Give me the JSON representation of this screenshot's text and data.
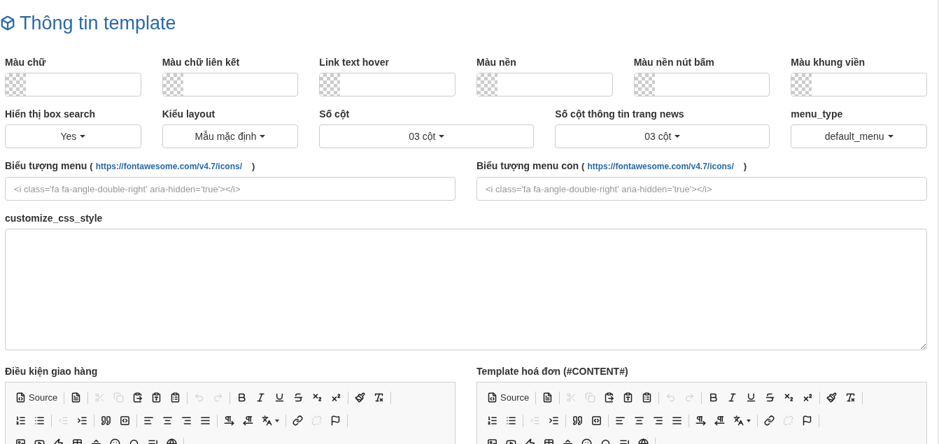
{
  "title": "Thông tin template",
  "color_fields": [
    {
      "label": "Màu chữ"
    },
    {
      "label": "Màu chữ liên kết"
    },
    {
      "label": "Link text hover"
    },
    {
      "label": "Màu nền"
    },
    {
      "label": "Màu nền nút bấm"
    },
    {
      "label": "Màu khung viền"
    }
  ],
  "selects": [
    {
      "label": "Hiển thị box search",
      "value": "Yes",
      "kind": "narrow"
    },
    {
      "label": "Kiểu layout",
      "value": "Mẫu mặc định",
      "kind": "narrow"
    },
    {
      "label": "Số cột",
      "value": "03 cột",
      "kind": "wide"
    },
    {
      "label": "Số cột thông tin trang news",
      "value": "03 cột",
      "kind": "wide"
    },
    {
      "label": "menu_type",
      "value": "default_menu",
      "kind": "narrow"
    }
  ],
  "icon_fields": [
    {
      "label": "Biểu tượng menu",
      "paren_open": "(",
      "link": "https://fontawesome.com/v4.7/icons/",
      "paren_close": ")",
      "placeholder": "<i class='fa fa-angle-double-right' aria-hidden='true'></i>"
    },
    {
      "label": "Biểu tượng menu con",
      "paren_open": "(",
      "link": "https://fontawesome.com/v4.7/icons/",
      "paren_close": ")",
      "placeholder": "<i class='fa fa-angle-double-right' aria-hidden='true'></i>"
    }
  ],
  "css_field": {
    "label": "customize_css_style"
  },
  "editors": [
    {
      "label": "Điều kiện giao hàng",
      "toolbar": [
        [
          [
            {
              "kind": "source",
              "label": "Source",
              "disabled": false
            }
          ],
          [
            {
              "kind": "newpage",
              "disabled": false
            }
          ],
          [
            {
              "kind": "cut",
              "disabled": true
            },
            {
              "kind": "copy",
              "disabled": true
            },
            {
              "kind": "paste",
              "disabled": false
            },
            {
              "kind": "pastetext",
              "disabled": false
            },
            {
              "kind": "pasteword",
              "disabled": false
            }
          ],
          [
            {
              "kind": "undo",
              "disabled": true
            },
            {
              "kind": "redo",
              "disabled": true
            }
          ],
          [
            {
              "kind": "bold",
              "disabled": false
            },
            {
              "kind": "italic",
              "disabled": false
            },
            {
              "kind": "underline",
              "disabled": false
            },
            {
              "kind": "strike",
              "disabled": false
            },
            {
              "kind": "subscript",
              "disabled": false
            },
            {
              "kind": "superscript",
              "disabled": false
            }
          ],
          [
            {
              "kind": "copyformat",
              "disabled": false
            },
            {
              "kind": "removeformat",
              "disabled": false
            }
          ]
        ],
        [
          [
            {
              "kind": "numberedlist",
              "disabled": false
            },
            {
              "kind": "bulletedlist",
              "disabled": false
            }
          ],
          [
            {
              "kind": "outdent",
              "disabled": true
            },
            {
              "kind": "indent",
              "disabled": false
            }
          ],
          [
            {
              "kind": "blockquote",
              "disabled": false
            },
            {
              "kind": "creatediv",
              "disabled": false
            }
          ],
          [
            {
              "kind": "alignleft",
              "disabled": false
            },
            {
              "kind": "aligncenter",
              "disabled": false
            },
            {
              "kind": "alignright",
              "disabled": false
            },
            {
              "kind": "justify",
              "disabled": false
            }
          ],
          [
            {
              "kind": "ltr",
              "disabled": false
            },
            {
              "kind": "rtl",
              "disabled": false
            },
            {
              "kind": "language",
              "disabled": false
            }
          ],
          [
            {
              "kind": "link",
              "disabled": false
            },
            {
              "kind": "unlink",
              "disabled": true
            },
            {
              "kind": "anchor",
              "disabled": false
            }
          ]
        ],
        [
          [
            {
              "kind": "image",
              "disabled": false
            },
            {
              "kind": "youtube",
              "disabled": false
            },
            {
              "kind": "flash",
              "disabled": false
            },
            {
              "kind": "table",
              "disabled": false
            },
            {
              "kind": "hr",
              "disabled": false
            },
            {
              "kind": "smiley",
              "disabled": false
            },
            {
              "kind": "specialchar",
              "disabled": false
            },
            {
              "kind": "pagebreak",
              "disabled": false
            },
            {
              "kind": "iframe",
              "disabled": false
            }
          ]
        ]
      ]
    },
    {
      "label": "Template hoá đơn (#CONTENT#)",
      "toolbar": [
        [
          [
            {
              "kind": "source",
              "label": "Source",
              "disabled": false
            }
          ],
          [
            {
              "kind": "newpage",
              "disabled": false
            }
          ],
          [
            {
              "kind": "cut",
              "disabled": true
            },
            {
              "kind": "copy",
              "disabled": true
            },
            {
              "kind": "paste",
              "disabled": false
            },
            {
              "kind": "pastetext",
              "disabled": false
            },
            {
              "kind": "pasteword",
              "disabled": false
            }
          ],
          [
            {
              "kind": "undo",
              "disabled": true
            },
            {
              "kind": "redo",
              "disabled": true
            }
          ],
          [
            {
              "kind": "bold",
              "disabled": false
            },
            {
              "kind": "italic",
              "disabled": false
            },
            {
              "kind": "underline",
              "disabled": false
            },
            {
              "kind": "strike",
              "disabled": false
            },
            {
              "kind": "subscript",
              "disabled": false
            },
            {
              "kind": "superscript",
              "disabled": false
            }
          ],
          [
            {
              "kind": "copyformat",
              "disabled": false
            },
            {
              "kind": "removeformat",
              "disabled": false
            }
          ]
        ],
        [
          [
            {
              "kind": "numberedlist",
              "disabled": false
            },
            {
              "kind": "bulletedlist",
              "disabled": false
            }
          ],
          [
            {
              "kind": "outdent",
              "disabled": true
            },
            {
              "kind": "indent",
              "disabled": false
            }
          ],
          [
            {
              "kind": "blockquote",
              "disabled": false
            },
            {
              "kind": "creatediv",
              "disabled": false
            }
          ],
          [
            {
              "kind": "alignleft",
              "disabled": false
            },
            {
              "kind": "aligncenter",
              "disabled": false
            },
            {
              "kind": "alignright",
              "disabled": false
            },
            {
              "kind": "justify",
              "disabled": false
            }
          ],
          [
            {
              "kind": "ltr",
              "disabled": false
            },
            {
              "kind": "rtl",
              "disabled": false
            },
            {
              "kind": "language",
              "disabled": false
            }
          ],
          [
            {
              "kind": "link",
              "disabled": false
            },
            {
              "kind": "unlink",
              "disabled": true
            },
            {
              "kind": "anchor",
              "disabled": false
            }
          ]
        ],
        [
          [
            {
              "kind": "image",
              "disabled": false
            },
            {
              "kind": "youtube",
              "disabled": false
            },
            {
              "kind": "flash",
              "disabled": false
            },
            {
              "kind": "table",
              "disabled": false
            },
            {
              "kind": "hr",
              "disabled": false
            },
            {
              "kind": "smiley",
              "disabled": false
            },
            {
              "kind": "specialchar",
              "disabled": false
            },
            {
              "kind": "pagebreak",
              "disabled": false
            },
            {
              "kind": "iframe",
              "disabled": false
            }
          ]
        ]
      ]
    }
  ]
}
